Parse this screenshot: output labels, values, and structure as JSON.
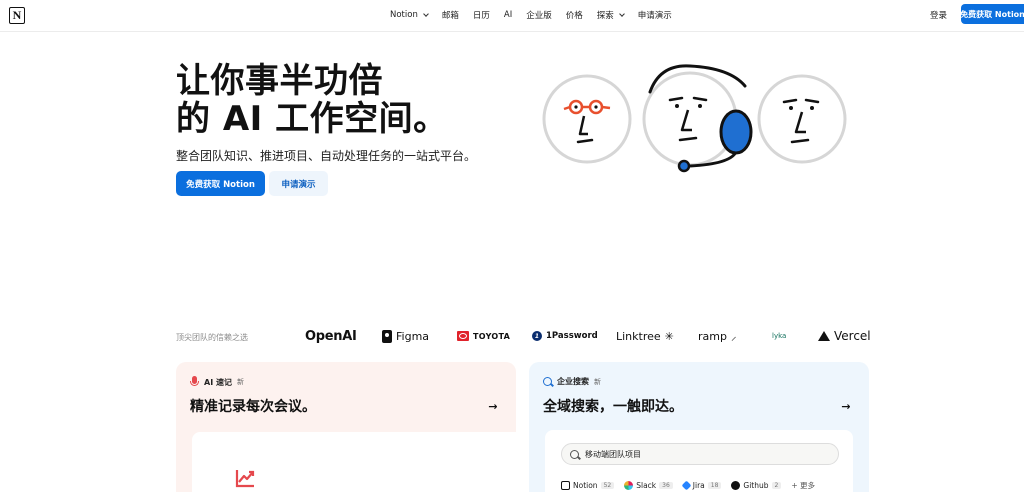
{
  "nav": {
    "logo_letter": "N",
    "items": [
      {
        "label": "Notion",
        "dropdown": true
      },
      {
        "label": "邮箱",
        "dropdown": false
      },
      {
        "label": "日历",
        "dropdown": false
      },
      {
        "label": "AI",
        "dropdown": false
      },
      {
        "label": "企业版",
        "dropdown": false
      },
      {
        "label": "价格",
        "dropdown": false
      },
      {
        "label": "探索",
        "dropdown": true
      },
      {
        "label": "申请演示",
        "dropdown": false
      }
    ],
    "login": "登录",
    "cta": "免费获取 Notion"
  },
  "hero": {
    "title_line1": "让你事半功倍",
    "title_line2": "的 AI 工作空间。",
    "subtitle": "整合团队知识、推进项目、自动处理任务的一站式平台。",
    "primary_button": "免费获取 Notion",
    "secondary_button": "申请演示"
  },
  "trust": {
    "label": "顶尖团队的信赖之选",
    "logos": [
      "OpenAI",
      "Figma",
      "TOYOTA",
      "1Password",
      "Linktree",
      "ramp",
      "lyka",
      "Vercel"
    ]
  },
  "cards": {
    "left": {
      "tag": "AI 速记",
      "badge": "新",
      "title": "精准记录每次会议。",
      "arrow": "→"
    },
    "right": {
      "tag": "企业搜索",
      "badge": "新",
      "title": "全域搜索，一触即达。",
      "arrow": "→",
      "search_text": "移动端团队项目",
      "sources": [
        {
          "name": "Notion",
          "count": "52",
          "icon": "notion-icon"
        },
        {
          "name": "Slack",
          "count": "36",
          "icon": "slack-icon"
        },
        {
          "name": "Jira",
          "count": "18",
          "icon": "jira-icon"
        },
        {
          "name": "Github",
          "count": "2",
          "icon": "github-icon"
        }
      ],
      "more": "+ 更多"
    }
  },
  "colors": {
    "accent": "#0b6fde",
    "card_left_bg": "#fdf2ef",
    "card_right_bg": "#eef6fd",
    "face_orange": "#e8502e",
    "face_blue": "#1f6fd1"
  }
}
